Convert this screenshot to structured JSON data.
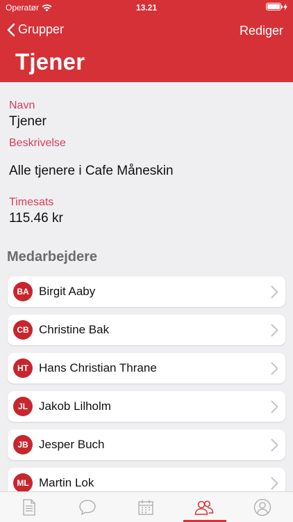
{
  "status": {
    "carrier": "Operatør",
    "time": "13.21",
    "battery_level": 1.0
  },
  "nav": {
    "back_label": "Grupper",
    "edit_label": "Rediger",
    "title": "Tjener"
  },
  "fields": {
    "name_label": "Navn",
    "name_value": "Tjener",
    "description_label": "Beskrivelse",
    "description_value": "Alle tjenere i Cafe Måneskin",
    "rate_label": "Timesats",
    "rate_value": "115.46 kr"
  },
  "employees_title": "Medarbejdere",
  "employees": [
    {
      "initials": "BA",
      "name": "Birgit Aaby"
    },
    {
      "initials": "CB",
      "name": "Christine Bak"
    },
    {
      "initials": "HT",
      "name": "Hans Christian Thrane"
    },
    {
      "initials": "JL",
      "name": "Jakob Lilholm"
    },
    {
      "initials": "JB",
      "name": "Jesper Buch"
    },
    {
      "initials": "ML",
      "name": "Martin Lok"
    }
  ],
  "tabs": [
    {
      "icon": "document-icon",
      "active": false
    },
    {
      "icon": "chat-bubble-icon",
      "active": false
    },
    {
      "icon": "calendar-icon",
      "active": false
    },
    {
      "icon": "people-icon",
      "active": true
    },
    {
      "icon": "profile-icon",
      "active": false
    }
  ],
  "colors": {
    "accent": "#d63137",
    "label": "#d63e5a",
    "avatar": "#c8262d",
    "background": "#efeff1"
  }
}
